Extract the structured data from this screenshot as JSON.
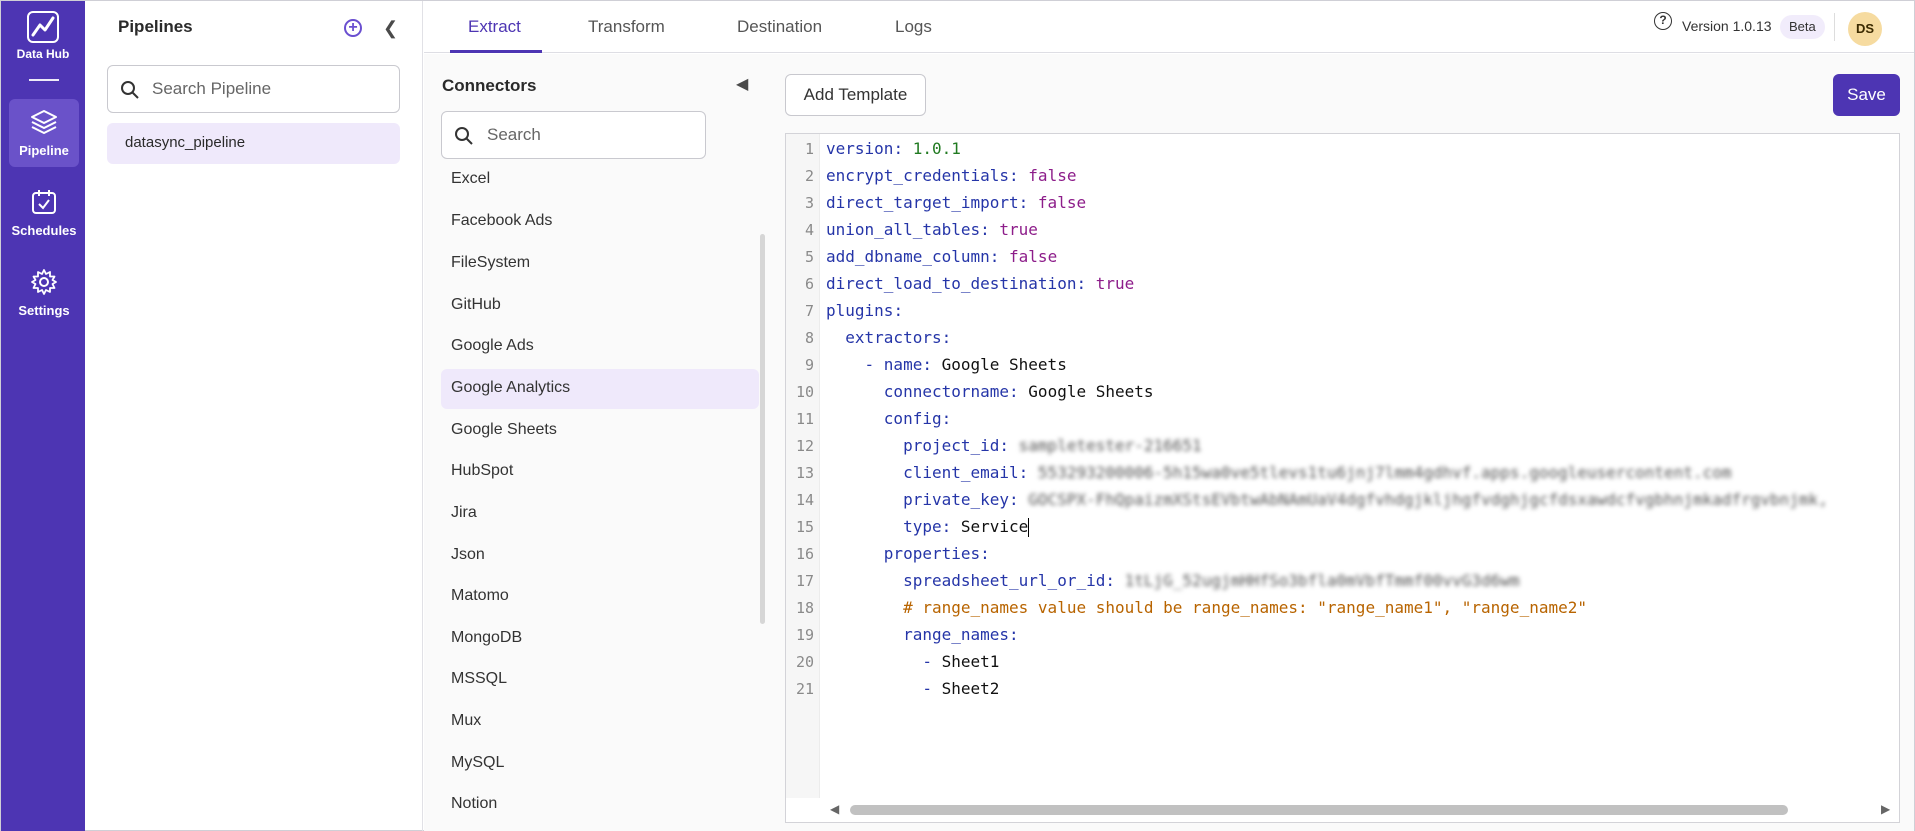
{
  "rail": {
    "logo_label": "Data Hub",
    "items": [
      {
        "label": "Pipeline",
        "icon": "layers-icon",
        "active": true
      },
      {
        "label": "Schedules",
        "icon": "calendar-check-icon",
        "active": false
      },
      {
        "label": "Settings",
        "icon": "gear-icon",
        "active": false
      }
    ]
  },
  "pipelines": {
    "title": "Pipelines",
    "search_placeholder": "Search Pipeline",
    "items": [
      "datasync_pipeline"
    ]
  },
  "tabs": {
    "items": [
      "Extract",
      "Transform",
      "Destination",
      "Logs"
    ],
    "active": "Extract"
  },
  "header": {
    "version": "Version 1.0.13",
    "badge": "Beta",
    "avatar_initials": "DS"
  },
  "connectors": {
    "title": "Connectors",
    "search_placeholder": "Search",
    "items": [
      "Excel",
      "Facebook Ads",
      "FileSystem",
      "GitHub",
      "Google Ads",
      "Google Analytics",
      "Google Sheets",
      "HubSpot",
      "Jira",
      "Json",
      "Matomo",
      "MongoDB",
      "MSSQL",
      "Mux",
      "MySQL",
      "Notion"
    ],
    "active": "Google Analytics"
  },
  "toolbar": {
    "add_template_label": "Add Template",
    "save_label": "Save"
  },
  "editor": {
    "line_numbers": [
      "1",
      "2",
      "3",
      "4",
      "5",
      "6",
      "7",
      "8",
      "9",
      "10",
      "11",
      "12",
      "13",
      "14",
      "15",
      "16",
      "17",
      "18",
      "19",
      "20",
      "21"
    ],
    "l1_key": "version",
    "l1_val": "1.0.1",
    "l2_key": "encrypt_credentials",
    "l2_val": "false",
    "l3_key": "direct_target_import",
    "l3_val": "false",
    "l4_key": "union_all_tables",
    "l4_val": "true",
    "l5_key": "add_dbname_column",
    "l5_val": "false",
    "l6_key": "direct_load_to_destination",
    "l6_val": "true",
    "l7_key": "plugins",
    "l8_key": "extractors",
    "l9_key": "name",
    "l9_val": "Google Sheets",
    "l10_key": "connectorname",
    "l10_val": "Google Sheets",
    "l11_key": "config",
    "l12_key": "project_id",
    "l12_val": "sampletester-216651",
    "l13_key": "client_email",
    "l13_val": "553293200006-5h15wa0ve5tlevs1tu6jnj7lmm4gdhvf.apps.googleusercontent.com",
    "l14_key": "private_key",
    "l14_val": "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fvhdgjkljhgfvdghjgcfdsxawdcfvgbhnjmkadfrgvbnjmk,",
    "l15_key": "type",
    "l15_val": "Service",
    "l16_key": "properties",
    "l17_key": "spreadsheet_url_or_id",
    "l17_val": "1tLjG_52ugjmHHfSo3bfla0mVbfTmmf00vvG3d6wm",
    "l18_comment": "# range_names value should be range_names: \"range_name1\", \"range_name2\"",
    "l19_key": "range_names",
    "l20_val": "Sheet1",
    "l21_val": "Sheet2"
  }
}
